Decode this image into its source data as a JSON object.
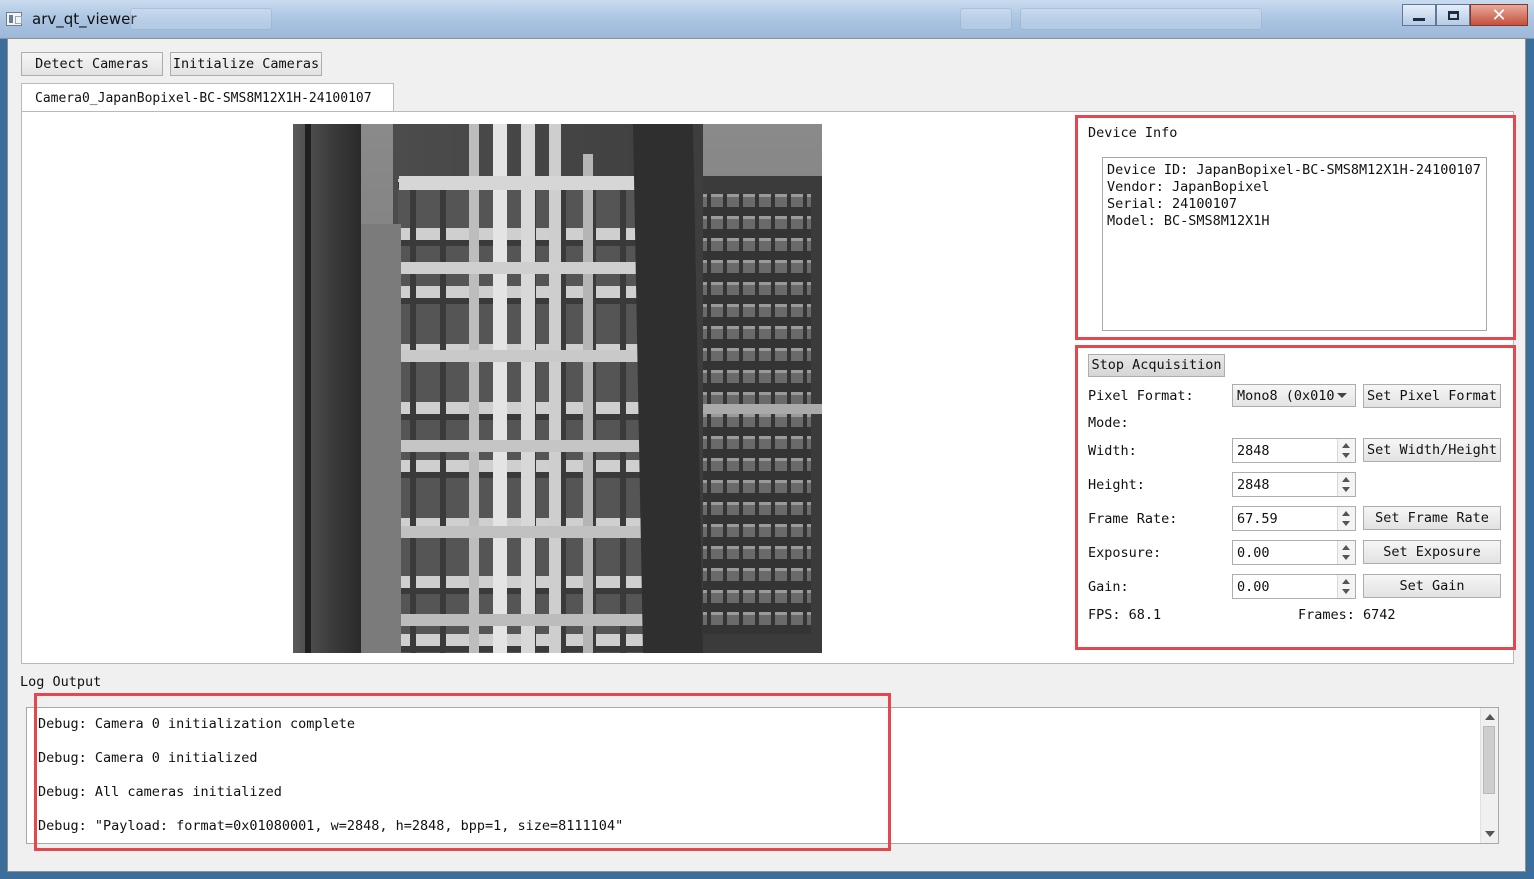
{
  "window": {
    "title": "arv_qt_viewer"
  },
  "toolbar": {
    "detect_label": "Detect Cameras",
    "initialize_label": "Initialize Cameras"
  },
  "tabs": [
    {
      "label": "Camera0_JapanBopixel-BC-SMS8M12X1H-24100107",
      "active": true
    }
  ],
  "device_info": {
    "title": "Device Info",
    "text": "Device ID: JapanBopixel-BC-SMS8M12X1H-24100107\nVendor: JapanBopixel\nSerial: 24100107\nModel: BC-SMS8M12X1H"
  },
  "controls": {
    "stop_acquisition_label": "Stop Acquisition",
    "pixel_format_label": "Pixel Format:",
    "pixel_format_value": "Mono8 (0x010",
    "set_pixel_format_label": "Set Pixel Format",
    "mode_label": "Mode:",
    "width_label": "Width:",
    "width_value": "2848",
    "set_width_height_label": "Set Width/Height",
    "height_label": "Height:",
    "height_value": "2848",
    "frame_rate_label": "Frame Rate:",
    "frame_rate_value": "67.59",
    "set_frame_rate_label": "Set Frame Rate",
    "exposure_label": "Exposure:",
    "exposure_value": "0.00",
    "set_exposure_label": "Set Exposure",
    "gain_label": "Gain:",
    "gain_value": "0.00",
    "set_gain_label": "Set Gain",
    "fps_text": "FPS: 68.1",
    "frames_text": "Frames: 6742"
  },
  "log": {
    "title": "Log Output",
    "lines": [
      "Debug: Camera 0 initialization complete",
      "Debug: Camera 0 initialized",
      "Debug: All cameras initialized",
      "Debug: \"Payload: format=0x01080001, w=2848, h=2848, bpp=1, size=8111104\""
    ]
  },
  "colors": {
    "highlight": "#e5474f",
    "window_bg": "#f0f0f0",
    "titlebar": "#a9c3e1"
  }
}
